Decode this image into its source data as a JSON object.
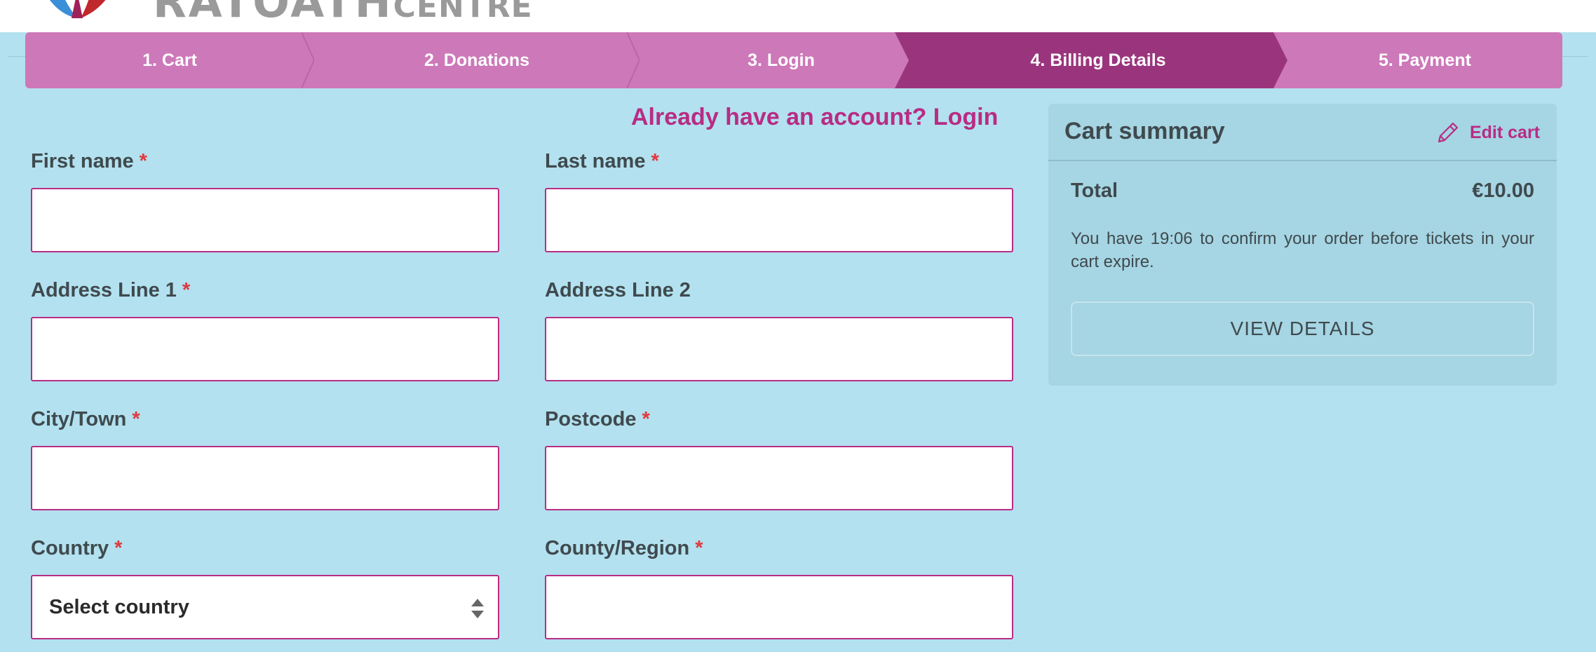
{
  "brand": {
    "logo_text": "RATOATH",
    "logo_small_text": "CENTRE",
    "colors": {
      "accent": "#b82c84",
      "step_bar": "#cd78b9",
      "step_active": "#9a357d",
      "page_bg": "#b3e1ef",
      "required": "#e0393e"
    }
  },
  "steps": [
    {
      "label": "1. Cart",
      "active": false
    },
    {
      "label": "2. Donations",
      "active": false
    },
    {
      "label": "3. Login",
      "active": false
    },
    {
      "label": "4. Billing Details",
      "active": true
    },
    {
      "label": "5. Payment",
      "active": false
    }
  ],
  "login_prompt": "Already have an account? Login",
  "form": {
    "required_mark": "*",
    "first_name": {
      "label": "First name",
      "value": ""
    },
    "last_name": {
      "label": "Last name",
      "value": ""
    },
    "address1": {
      "label": "Address Line 1",
      "value": ""
    },
    "address2": {
      "label": "Address Line 2",
      "value": ""
    },
    "city": {
      "label": "City/Town",
      "value": ""
    },
    "postcode": {
      "label": "Postcode",
      "value": ""
    },
    "country": {
      "label": "Country",
      "selected": "Select country"
    },
    "county": {
      "label": "County/Region",
      "value": ""
    }
  },
  "cart_summary": {
    "title": "Cart summary",
    "edit_label": "Edit cart",
    "edit_icon": "pencil-icon",
    "total_label": "Total",
    "total_value": "€10.00",
    "expire_text": "You have 19:06 to confirm your order before tickets in your cart expire.",
    "view_details_label": "VIEW DETAILS"
  }
}
